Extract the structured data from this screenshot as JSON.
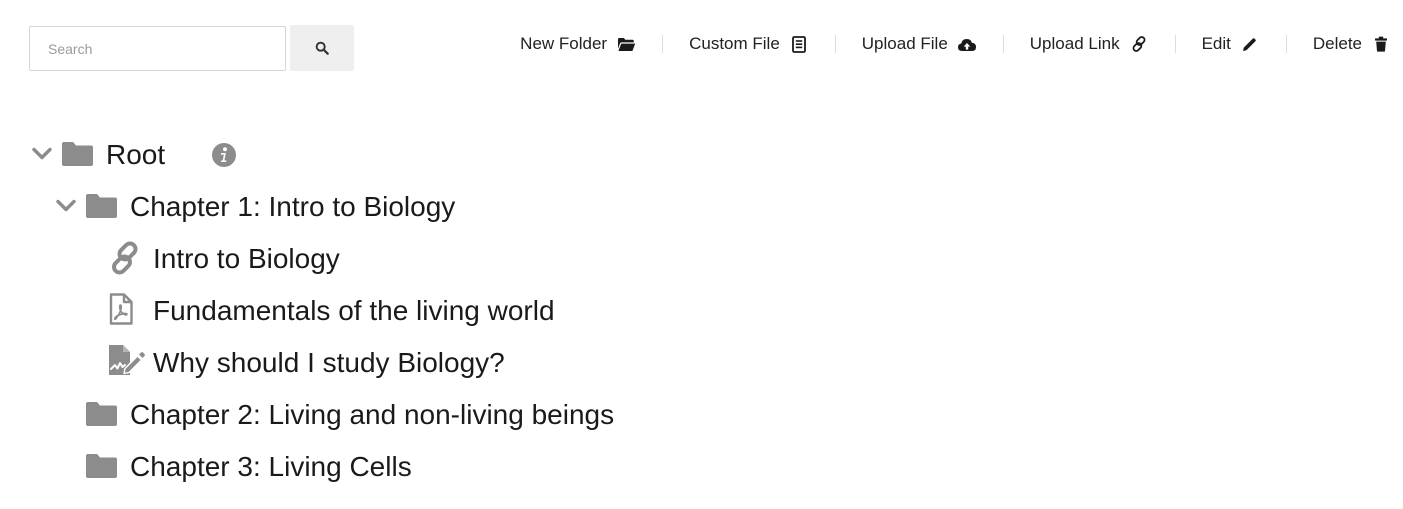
{
  "search": {
    "placeholder": "Search",
    "value": ""
  },
  "toolbar": {
    "new_folder": "New Folder",
    "custom_file": "Custom File",
    "upload_file": "Upload File",
    "upload_link": "Upload Link",
    "edit": "Edit",
    "delete": "Delete"
  },
  "tree": {
    "root": {
      "label": "Root",
      "expanded": true
    },
    "chapter1": {
      "label": "Chapter 1: Intro to Biology",
      "expanded": true
    },
    "item_link": {
      "label": "Intro to Biology",
      "icon": "link-icon"
    },
    "item_pdf": {
      "label": "Fundamentals of the living world",
      "icon": "pdf-file-icon"
    },
    "item_custom": {
      "label": "Why should I study Biology?",
      "icon": "file-signature-icon"
    },
    "chapter2": {
      "label": "Chapter 2: Living and non-living beings",
      "expanded": false
    },
    "chapter3": {
      "label": "Chapter 3: Living Cells",
      "expanded": false
    }
  },
  "colors": {
    "icon_gray": "#8c8c8c",
    "toolbar_icon": "#1a1a1a",
    "search_btn_bg": "#efefef"
  }
}
